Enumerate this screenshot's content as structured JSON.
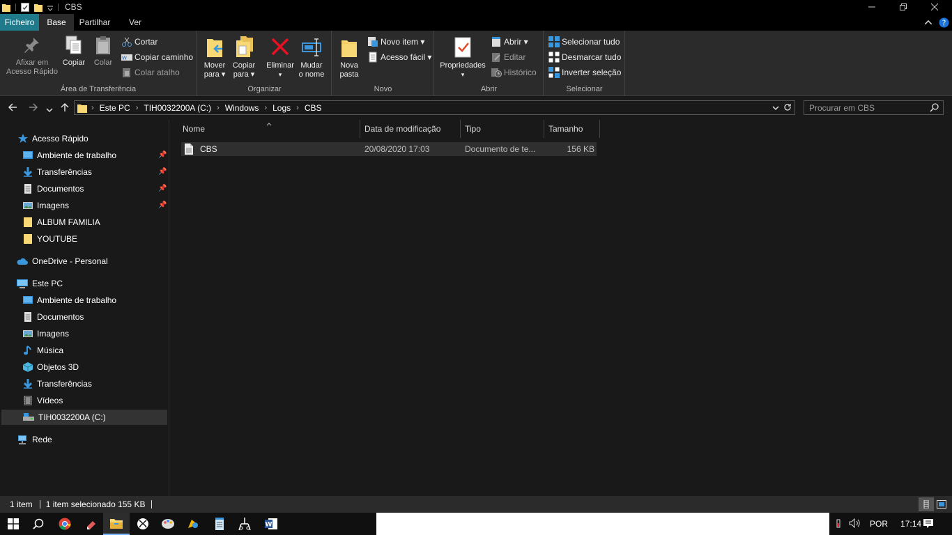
{
  "window": {
    "title": "CBS"
  },
  "tabs": {
    "file": "Ficheiro",
    "home": "Base",
    "share": "Partilhar",
    "view": "Ver"
  },
  "ribbon": {
    "clipboard": {
      "label": "Área de Transferência",
      "pin_line1": "Afixar em",
      "pin_line2": "Acesso Rápido",
      "copy": "Copiar",
      "paste": "Colar",
      "cut": "Cortar",
      "copy_path": "Copiar caminho",
      "paste_shortcut": "Colar atalho"
    },
    "organize": {
      "label": "Organizar",
      "move_line1": "Mover",
      "move_line2": "para ▾",
      "copyto_line1": "Copiar",
      "copyto_line2": "para ▾",
      "delete": "Eliminar",
      "delete_arrow": "▾",
      "rename_line1": "Mudar",
      "rename_line2": "o nome"
    },
    "new": {
      "label": "Novo",
      "folder_line1": "Nova",
      "folder_line2": "pasta",
      "new_item": "Novo item ▾",
      "easy_access": "Acesso fácil ▾"
    },
    "open": {
      "label": "Abrir",
      "properties": "Propriedades",
      "properties_arrow": "▾",
      "open": "Abrir ▾",
      "edit": "Editar",
      "history": "Histórico"
    },
    "select": {
      "label": "Selecionar",
      "select_all": "Selecionar tudo",
      "select_none": "Desmarcar tudo",
      "invert": "Inverter seleção"
    }
  },
  "address": {
    "crumbs": [
      "Este PC",
      "TIH0032200A (C:)",
      "Windows",
      "Logs",
      "CBS"
    ],
    "search_placeholder": "Procurar em CBS"
  },
  "sidebar": {
    "quick_access": "Acesso Rápido",
    "quick_items": [
      "Ambiente de trabalho",
      "Transferências",
      "Documentos",
      "Imagens",
      "ALBUM FAMILIA",
      "YOUTUBE"
    ],
    "onedrive": "OneDrive - Personal",
    "this_pc": "Este PC",
    "pc_items": [
      "Ambiente de trabalho",
      "Documentos",
      "Imagens",
      "Música",
      "Objetos 3D",
      "Transferências",
      "Vídeos",
      "TIH0032200A (C:)"
    ],
    "network": "Rede"
  },
  "columns": {
    "name": "Nome",
    "modified": "Data de modificação",
    "type": "Tipo",
    "size": "Tamanho"
  },
  "files": [
    {
      "name": "CBS",
      "modified": "20/08/2020 17:03",
      "type": "Documento de te...",
      "size": "156 KB"
    }
  ],
  "status": {
    "count": "1 item",
    "selected": "1 item selecionado 155 KB"
  },
  "tray": {
    "language": "POR",
    "time": "17:14"
  },
  "colors": {
    "accent": "#1f7a8c",
    "folder": "#f8d775",
    "delete": "#e81123",
    "link": "#3a96dd"
  }
}
